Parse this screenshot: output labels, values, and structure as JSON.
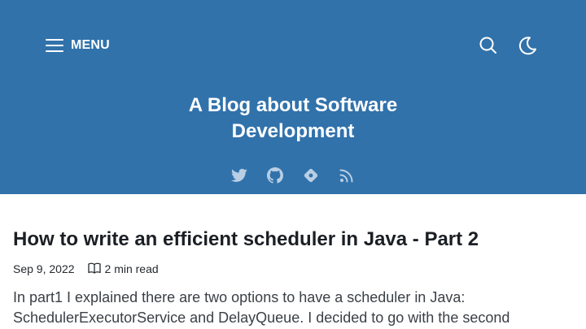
{
  "header": {
    "menu_label": "MENU",
    "title_line1": "A Blog about Software",
    "title_line2": "Development",
    "social_icons": [
      "twitter-icon",
      "github-icon",
      "git-icon",
      "rss-icon"
    ]
  },
  "post": {
    "title": "How to write an efficient scheduler in Java - Part 2",
    "date": "Sep 9, 2022",
    "read_time": "2 min read",
    "excerpt_line1": "In part1 I explained there are two options to have a scheduler in Java:",
    "excerpt_line2": "SchedulerExecutorService and DelayQueue. I decided to go with the second"
  },
  "colors": {
    "header_bg": "#3172ab",
    "header_text": "#ffffff",
    "social_icon": "#b9cfe4"
  }
}
